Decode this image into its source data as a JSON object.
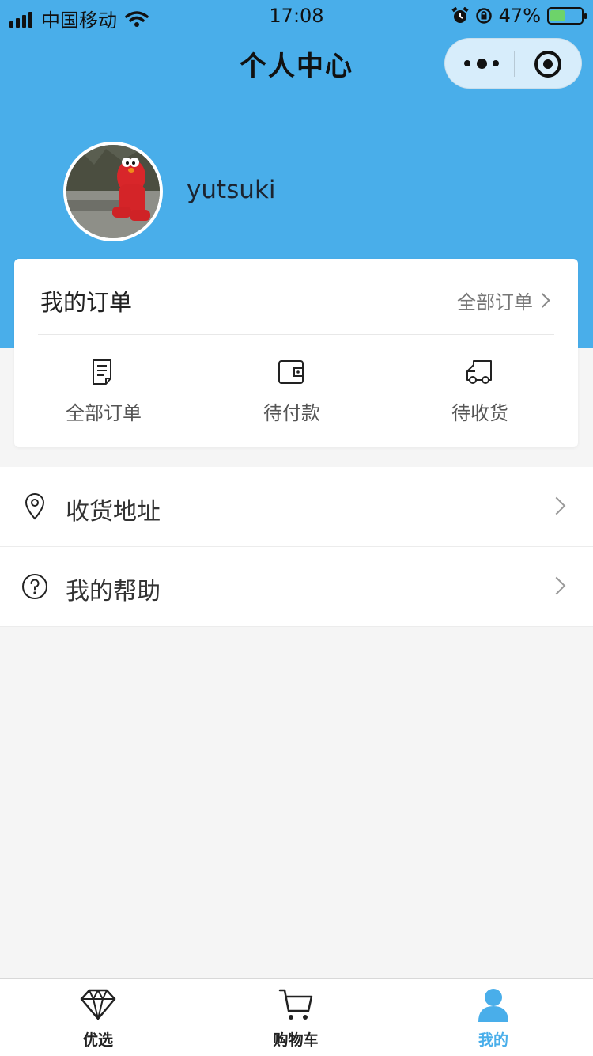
{
  "status_bar": {
    "carrier": "中国移动",
    "time": "17:08",
    "battery": "47%",
    "battery_level": 0.47,
    "icons": [
      "signal-icon",
      "wifi-icon",
      "alarm-icon",
      "rotation-lock-icon",
      "battery-charging-icon"
    ]
  },
  "nav": {
    "title": "个人中心",
    "capsule_icons": [
      "more-icon",
      "target-icon"
    ]
  },
  "profile": {
    "username": "yutsuki",
    "avatar_icon": "avatar-photo"
  },
  "orders": {
    "title": "我的订单",
    "all_link": "全部订单",
    "items": [
      {
        "label": "全部订单",
        "icon": "document-icon"
      },
      {
        "label": "待付款",
        "icon": "wallet-icon"
      },
      {
        "label": "待收货",
        "icon": "truck-icon"
      }
    ]
  },
  "menu": [
    {
      "label": "收货地址",
      "icon": "location-pin-icon"
    },
    {
      "label": "我的帮助",
      "icon": "question-circle-icon"
    }
  ],
  "tabbar": [
    {
      "label": "优选",
      "icon": "diamond-icon",
      "active": false
    },
    {
      "label": "购物车",
      "icon": "cart-icon",
      "active": false
    },
    {
      "label": "我的",
      "icon": "user-icon",
      "active": true
    }
  ],
  "colors": {
    "accent": "#49aeea",
    "background": "#f5f5f5",
    "battery": "#6dd36a"
  }
}
